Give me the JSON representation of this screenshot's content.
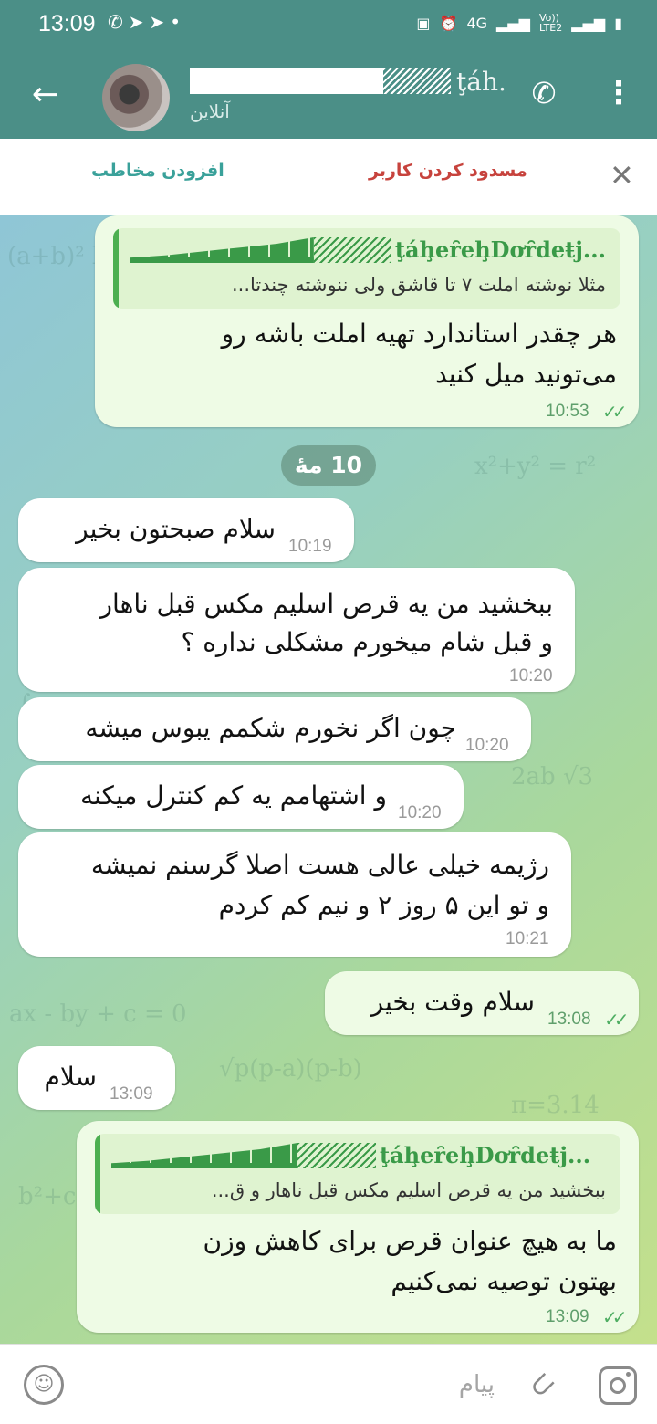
{
  "status_bar": {
    "time": "13:09",
    "left_icons": [
      "whatsapp-icon",
      "telegram-icon",
      "telegram-icon",
      "dot-icon"
    ],
    "right_icons": [
      "battery-saver-icon",
      "alarm-icon",
      "4g-icon",
      "signal-icon",
      "volte-icon",
      "signal-icon",
      "battery-icon"
    ],
    "network_label": "4G",
    "volte_label": "Vo))\nLTE2"
  },
  "header": {
    "name": "ţáh...",
    "status": "آنلاین"
  },
  "action_bar": {
    "add_contact": "افزودن مخاطب",
    "block_user": "مسدود کردن کاربر"
  },
  "chat": {
    "date_chip": "10 مهٔ",
    "messages": [
      {
        "direction": "out",
        "reply_name": "ţáḩeȓeḩDơȓdeŧj...",
        "reply_text": "مثلا نوشته املت ۷ تا قاشق ولی ننوشته چندتا...",
        "lines": [
          "هر چقدر استاندارد تهیه املت باشه رو",
          "می‌تونید میل کنید"
        ],
        "time": "10:53",
        "read": true
      },
      {
        "direction": "in",
        "lines": [
          "سلام صبحتون بخیر"
        ],
        "time": "10:19"
      },
      {
        "direction": "in",
        "lines": [
          "ببخشید من یه قرص اسلیم مکس قبل ناهار",
          "و قبل شام میخورم مشکلی نداره ؟"
        ],
        "time": "10:20"
      },
      {
        "direction": "in",
        "lines": [
          "چون اگر نخورم شکمم یبوس میشه"
        ],
        "time": "10:20"
      },
      {
        "direction": "in",
        "lines": [
          "و اشتهامم یه کم کنترل میکنه"
        ],
        "time": "10:20"
      },
      {
        "direction": "in",
        "lines": [
          "رژیمه خیلی عالی هست اصلا گرسنم نمیشه",
          "و تو این ۵ روز ۲ و نیم کم کردم"
        ],
        "time": "10:21"
      },
      {
        "direction": "out",
        "lines": [
          "سلام وقت بخیر"
        ],
        "time": "13:08",
        "read": true
      },
      {
        "direction": "in",
        "lines": [
          "سلام"
        ],
        "time": "13:09"
      },
      {
        "direction": "out",
        "reply_name": "ţáḩeȓeḩDơȓdeŧj...",
        "reply_text": "ببخشید من یه قرص اسلیم مکس قبل ناهار و ق...",
        "lines": [
          "ما به هیچ عنوان قرص برای کاهش وزن",
          "بهتون توصیه نمی‌کنیم"
        ],
        "time": "13:09",
        "read": true
      }
    ]
  },
  "input_bar": {
    "placeholder": "پیام",
    "value": ""
  },
  "colors": {
    "header": "#4b8f87",
    "incoming_bubble": "#ffffff",
    "outgoing_bubble": "#eefbe5",
    "read_check": "#4fae63",
    "block_text": "#c7433d",
    "add_text": "#3aa19a"
  }
}
